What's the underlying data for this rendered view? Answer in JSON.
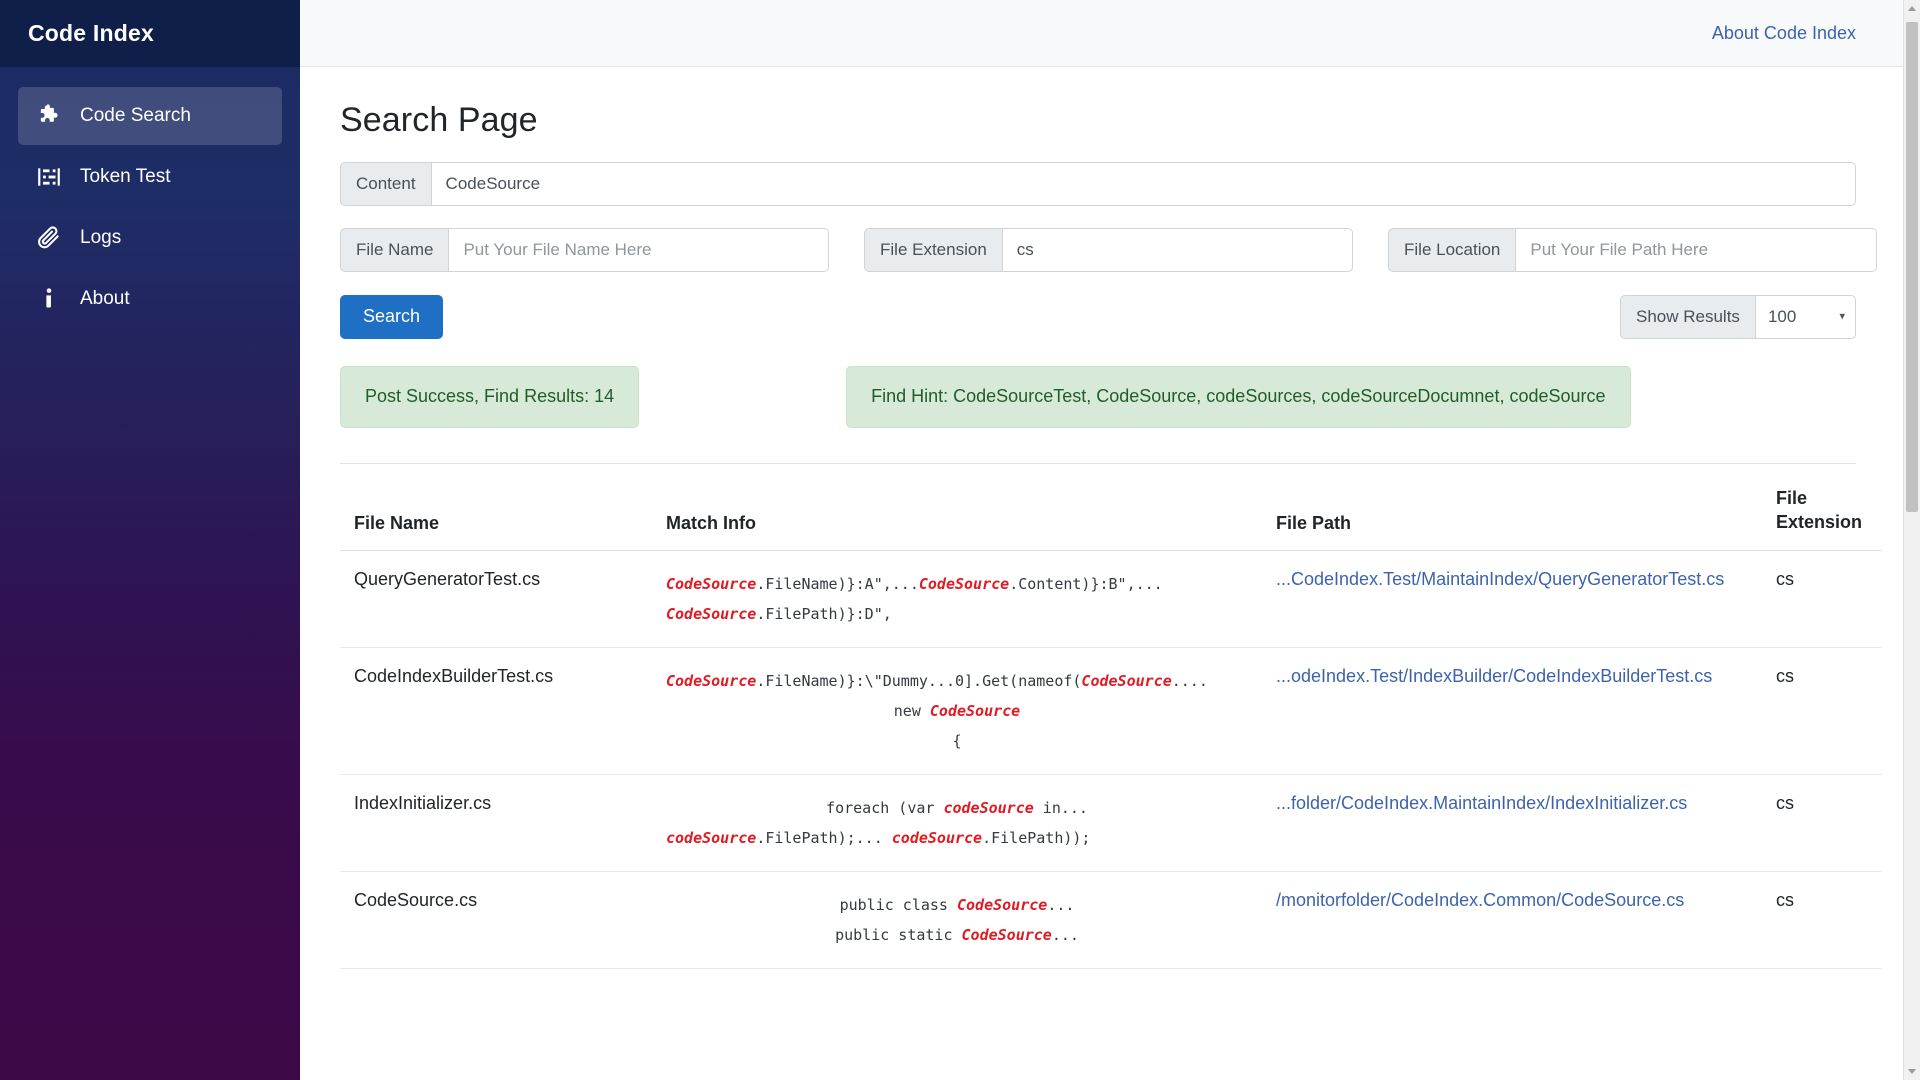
{
  "sidebar": {
    "title": "Code Index",
    "items": [
      {
        "label": "Code Search",
        "icon": "puzzle-icon",
        "active": true
      },
      {
        "label": "Token Test",
        "icon": "token-icon",
        "active": false
      },
      {
        "label": "Logs",
        "icon": "paperclip-icon",
        "active": false
      },
      {
        "label": "About",
        "icon": "info-icon",
        "active": false
      }
    ]
  },
  "topbar": {
    "about_link": "About Code Index"
  },
  "page": {
    "title": "Search Page"
  },
  "search_form": {
    "content": {
      "label": "Content",
      "value": "CodeSource",
      "placeholder": ""
    },
    "file_name": {
      "label": "File Name",
      "value": "",
      "placeholder": "Put Your File Name Here"
    },
    "file_extension": {
      "label": "File Extension",
      "value": "cs",
      "placeholder": ""
    },
    "file_location": {
      "label": "File Location",
      "value": "",
      "placeholder": "Put Your File Path Here"
    },
    "search_button": "Search",
    "show_results": {
      "label": "Show Results",
      "value": "100",
      "caret": "▾",
      "options": [
        "100"
      ]
    }
  },
  "alerts": {
    "success": "Post Success, Find Results: 14",
    "hint": "Find Hint: CodeSourceTest, CodeSource, codeSources, codeSourceDocumnet, codeSource"
  },
  "results_table": {
    "columns": [
      "File Name",
      "Match Info",
      "File Path",
      "File Extension"
    ],
    "column_file_extension_line1": "File",
    "column_file_extension_line2": "Extension",
    "rows": [
      {
        "file_name": "QueryGeneratorTest.cs",
        "match_lines": [
          {
            "align": "left",
            "parts": [
              {
                "t": "CodeSource",
                "hl": true
              },
              {
                "t": ".FileName)}:A\",...",
                "hl": false
              },
              {
                "t": "CodeSource",
                "hl": true
              },
              {
                "t": ".Content)}:B\",...",
                "hl": false
              }
            ]
          },
          {
            "align": "left",
            "parts": [
              {
                "t": "CodeSource",
                "hl": true
              },
              {
                "t": ".FilePath)}:D\",",
                "hl": false
              }
            ]
          }
        ],
        "file_path": "...CodeIndex.Test/MaintainIndex/QueryGeneratorTest.cs",
        "file_extension": "cs"
      },
      {
        "file_name": "CodeIndexBuilderTest.cs",
        "match_lines": [
          {
            "align": "left",
            "parts": [
              {
                "t": "CodeSource",
                "hl": true
              },
              {
                "t": ".FileName)}:\\\"Dummy...0].Get(nameof(",
                "hl": false
              },
              {
                "t": "CodeSource",
                "hl": true
              },
              {
                "t": "....",
                "hl": false
              }
            ]
          },
          {
            "align": "center",
            "parts": [
              {
                "t": "new ",
                "hl": false
              },
              {
                "t": "CodeSource",
                "hl": true
              }
            ]
          },
          {
            "align": "center",
            "parts": [
              {
                "t": "{",
                "hl": false
              }
            ]
          }
        ],
        "file_path": "...odeIndex.Test/IndexBuilder/CodeIndexBuilderTest.cs",
        "file_extension": "cs"
      },
      {
        "file_name": "IndexInitializer.cs",
        "match_lines": [
          {
            "align": "center",
            "parts": [
              {
                "t": "foreach (var ",
                "hl": false
              },
              {
                "t": "codeSource",
                "hl": true
              },
              {
                "t": " in...",
                "hl": false
              }
            ]
          },
          {
            "align": "left",
            "parts": [
              {
                "t": "codeSource",
                "hl": true
              },
              {
                "t": ".FilePath);... ",
                "hl": false
              },
              {
                "t": "codeSource",
                "hl": true
              },
              {
                "t": ".FilePath));",
                "hl": false
              }
            ]
          }
        ],
        "file_path": "...folder/CodeIndex.MaintainIndex/IndexInitializer.cs",
        "file_extension": "cs"
      },
      {
        "file_name": "CodeSource.cs",
        "match_lines": [
          {
            "align": "center",
            "parts": [
              {
                "t": "public class ",
                "hl": false
              },
              {
                "t": "CodeSource",
                "hl": true
              },
              {
                "t": "...",
                "hl": false
              }
            ]
          },
          {
            "align": "center",
            "parts": [
              {
                "t": "public static ",
                "hl": false
              },
              {
                "t": "CodeSource",
                "hl": true
              },
              {
                "t": "...",
                "hl": false
              }
            ]
          }
        ],
        "file_path": "/monitorfolder/CodeIndex.Common/CodeSource.cs",
        "file_extension": "cs"
      }
    ]
  },
  "colors": {
    "sidebar_top": "#1b2a63",
    "sidebar_bottom": "#3d0a47",
    "sidebar_header": "#101f4a",
    "primary_button": "#1f6fc4",
    "link": "#3d63ad",
    "alert_bg": "#d6ead7",
    "alert_border": "#c8e2ca",
    "alert_text": "#235c2c",
    "highlight": "#e01b24"
  }
}
